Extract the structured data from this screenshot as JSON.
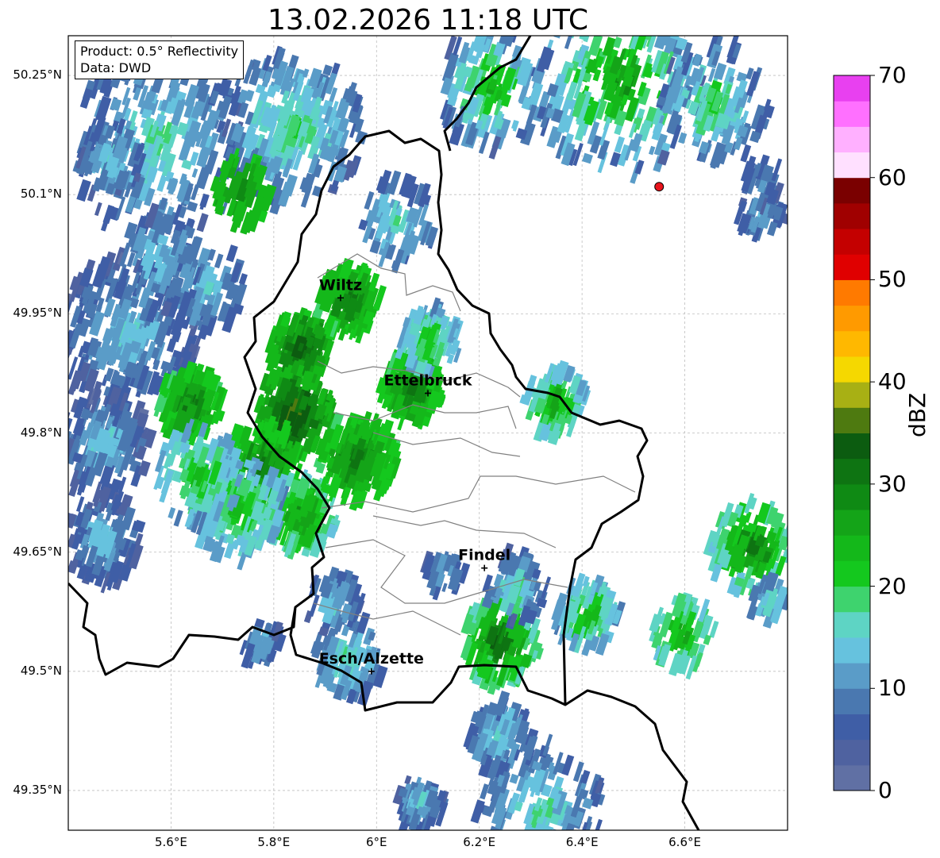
{
  "figure": {
    "title": "13.02.2026 11:18 UTC",
    "info_box": {
      "line1": "Product: 0.5° Reflectivity",
      "line2": "Data: DWD"
    }
  },
  "map": {
    "lon_range": [
      5.4,
      6.8
    ],
    "lat_range": [
      49.3,
      50.3
    ],
    "lat_ticks": [
      "50.25°N",
      "50.1°N",
      "49.95°N",
      "49.8°N",
      "49.65°N",
      "49.5°N",
      "49.35°N"
    ],
    "lon_ticks": [
      "5.6°E",
      "5.8°E",
      "6°E",
      "6.2°E",
      "6.4°E",
      "6.6°E"
    ],
    "grid": true,
    "cities": [
      {
        "name": "Wiltz",
        "lon": 5.93,
        "lat": 49.97
      },
      {
        "name": "Ettelbruck",
        "lon": 6.1,
        "lat": 49.85
      },
      {
        "name": "Findel",
        "lon": 6.21,
        "lat": 49.63
      },
      {
        "name": "Esch/Alzette",
        "lon": 5.99,
        "lat": 49.5
      }
    ],
    "radar_site": {
      "lon": 6.55,
      "lat": 50.11,
      "color": "#e8141c"
    }
  },
  "colorbar": {
    "label": "dBZ",
    "ticks": [
      "0",
      "10",
      "20",
      "30",
      "40",
      "50",
      "60",
      "70"
    ],
    "min": 0,
    "max": 70,
    "colors": [
      "#6070a4",
      "#4f62a0",
      "#3f5ea6",
      "#4a78b0",
      "#5a9cc8",
      "#66c2de",
      "#5ed4c4",
      "#3ed36e",
      "#14c81e",
      "#14b81a",
      "#14a418",
      "#0f8a14",
      "#0e7412",
      "#0c5c10",
      "#4e7a10",
      "#a8b014",
      "#f5d800",
      "#ffb800",
      "#ff9a00",
      "#ff7a00",
      "#e00000",
      "#c40000",
      "#a00000",
      "#7a0000",
      "#ffe0ff",
      "#ffb0ff",
      "#ff70ff",
      "#e840f0"
    ]
  }
}
